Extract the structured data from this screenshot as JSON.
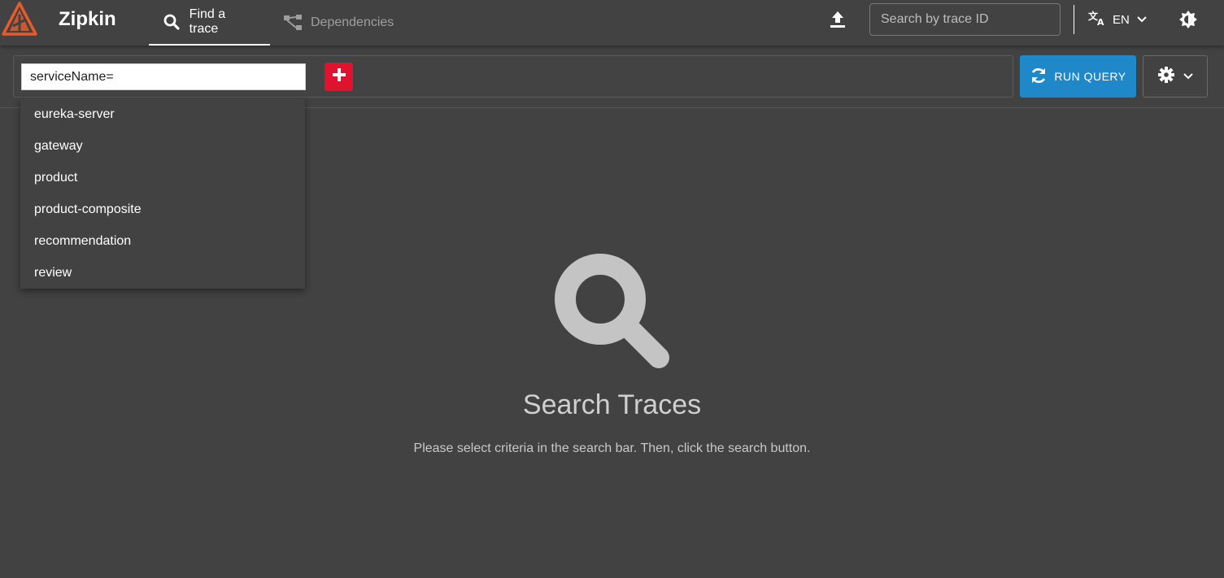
{
  "app": {
    "brand": "Zipkin",
    "brand_color": "#e85a2c",
    "logo_icon": "zipkin-logo-icon"
  },
  "nav": {
    "tabs": [
      {
        "label": "Find a trace",
        "icon": "search-icon",
        "active": true
      },
      {
        "label": "Dependencies",
        "icon": "dependencies-icon",
        "active": false
      }
    ]
  },
  "header": {
    "upload_icon": "upload-icon",
    "trace_search_placeholder": "Search by trace ID",
    "trace_search_value": "",
    "language_icon": "translate-icon",
    "language": "EN",
    "theme_icon": "brightness-icon"
  },
  "query": {
    "criteria_value": "serviceName=",
    "add_icon": "plus-icon",
    "add_color": "#e0122d",
    "run_label": "RUN QUERY",
    "run_icon": "refresh-icon",
    "run_color": "#1e88c8",
    "settings_icon": "gear-icon"
  },
  "suggestions": [
    "eureka-server",
    "gateway",
    "product",
    "product-composite",
    "recommendation",
    "review"
  ],
  "empty_state": {
    "icon": "search-icon",
    "title": "Search Traces",
    "description": "Please select criteria in the search bar. Then, click the search button."
  }
}
